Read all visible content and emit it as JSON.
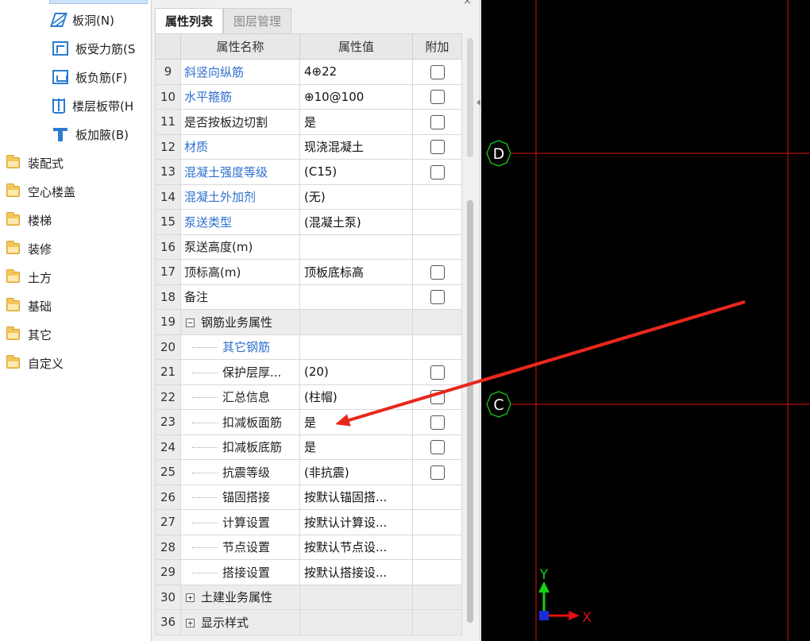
{
  "tree": {
    "items": [
      {
        "label": "板洞(N)",
        "icon": "slab-hole-icon"
      },
      {
        "label": "板受力筋(S",
        "icon": "slab-rebar-icon"
      },
      {
        "label": "板负筋(F)",
        "icon": "slab-negative-rebar-icon"
      },
      {
        "label": "楼层板带(H",
        "icon": "floor-band-icon"
      },
      {
        "label": "板加腋(B)",
        "icon": "slab-haunch-icon"
      }
    ],
    "folders": [
      "装配式",
      "空心楼盖",
      "楼梯",
      "装修",
      "土方",
      "基础",
      "其它",
      "自定义"
    ]
  },
  "panel": {
    "close_glyph": "×",
    "tabs": {
      "property_list": "属性列表",
      "layer_management": "图层管理"
    },
    "headers": {
      "name": "属性名称",
      "value": "属性值",
      "extra": "附加"
    },
    "rows": [
      {
        "num": "9",
        "name": "斜竖向纵筋",
        "value": "4⊕22",
        "color": "blue",
        "checkbox": true
      },
      {
        "num": "10",
        "name": "水平箍筋",
        "value": "⊕10@100",
        "color": "blue",
        "checkbox": true
      },
      {
        "num": "11",
        "name": "是否按板边切割",
        "value": "是",
        "color": "black",
        "checkbox": true
      },
      {
        "num": "12",
        "name": "材质",
        "value": "现浇混凝土",
        "color": "blue",
        "checkbox": true
      },
      {
        "num": "13",
        "name": "混凝土强度等级",
        "value": "(C15)",
        "color": "blue",
        "checkbox": true
      },
      {
        "num": "14",
        "name": "混凝土外加剂",
        "value": "(无)",
        "color": "blue",
        "checkbox": false
      },
      {
        "num": "15",
        "name": "泵送类型",
        "value": "(混凝土泵)",
        "color": "blue",
        "checkbox": false
      },
      {
        "num": "16",
        "name": "泵送高度(m)",
        "value": "",
        "color": "black",
        "checkbox": false
      },
      {
        "num": "17",
        "name": "顶标高(m)",
        "value": "顶板底标高",
        "color": "black",
        "checkbox": true
      },
      {
        "num": "18",
        "name": "备注",
        "value": "",
        "color": "black",
        "checkbox": true
      },
      {
        "num": "19",
        "name": "钢筋业务属性",
        "value": "",
        "color": "black",
        "checkbox": false,
        "group": "−"
      },
      {
        "num": "20",
        "name": "其它钢筋",
        "value": "",
        "color": "blue",
        "checkbox": false,
        "child": true
      },
      {
        "num": "21",
        "name": "保护层厚...",
        "value": "(20)",
        "color": "black",
        "checkbox": true,
        "child": true
      },
      {
        "num": "22",
        "name": "汇总信息",
        "value": "(柱帽)",
        "color": "black",
        "checkbox": true,
        "child": true
      },
      {
        "num": "23",
        "name": "扣减板面筋",
        "value": "是",
        "color": "black",
        "checkbox": true,
        "child": true
      },
      {
        "num": "24",
        "name": "扣减板底筋",
        "value": "是",
        "color": "black",
        "checkbox": true,
        "child": true
      },
      {
        "num": "25",
        "name": "抗震等级",
        "value": "(非抗震)",
        "color": "black",
        "checkbox": true,
        "child": true
      },
      {
        "num": "26",
        "name": "锚固搭接",
        "value": "按默认锚固搭...",
        "color": "black",
        "checkbox": false,
        "child": true
      },
      {
        "num": "27",
        "name": "计算设置",
        "value": "按默认计算设...",
        "color": "black",
        "checkbox": false,
        "child": true
      },
      {
        "num": "28",
        "name": "节点设置",
        "value": "按默认节点设...",
        "color": "black",
        "checkbox": false,
        "child": true
      },
      {
        "num": "29",
        "name": "搭接设置",
        "value": "按默认搭接设...",
        "color": "black",
        "checkbox": false,
        "child": true
      },
      {
        "num": "30",
        "name": "土建业务属性",
        "value": "",
        "color": "black",
        "checkbox": false,
        "group": "+"
      },
      {
        "num": "36",
        "name": "显示样式",
        "value": "",
        "color": "black",
        "checkbox": false,
        "group": "+"
      }
    ]
  },
  "canvas": {
    "axis_labels": {
      "d": "D",
      "c": "C"
    },
    "ucs": {
      "y": "Y",
      "x": "X"
    },
    "colors": {
      "background": "#000000",
      "grid": "#e01010",
      "axis_circle": "#18c018",
      "arrow": "#e8271c",
      "ucs_y": "#18d018",
      "ucs_x": "#e01010",
      "ucs_origin": "#1a2bd8"
    }
  }
}
